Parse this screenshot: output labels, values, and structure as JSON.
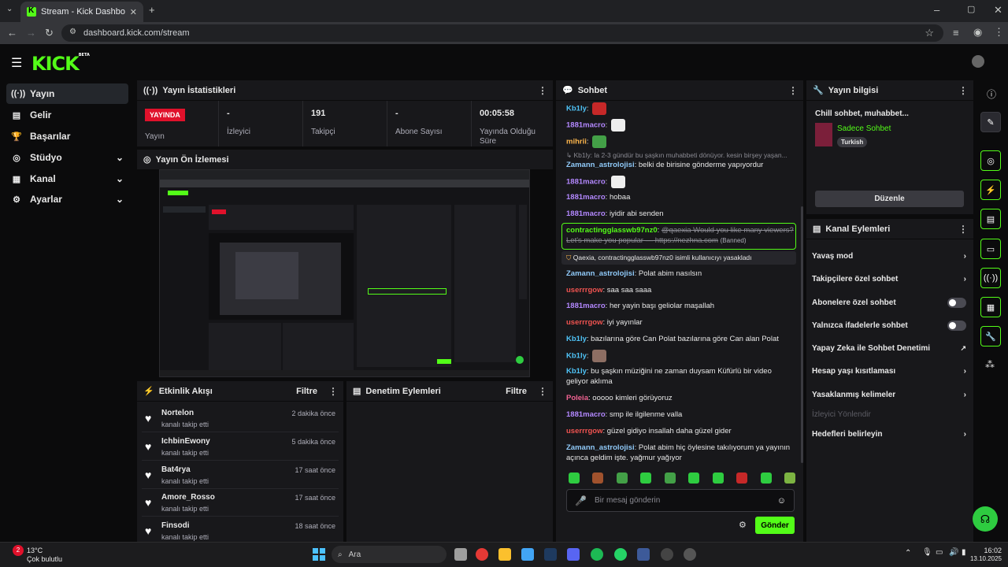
{
  "browser": {
    "tab_title": "Stream - Kick Dashboard",
    "url": "dashboard.kick.com/stream"
  },
  "brand": {
    "logo": "KICK",
    "beta": "BETA",
    "accent": "#53fc18"
  },
  "sidebar": {
    "items": [
      {
        "label": "Yayın",
        "icon": "broadcast-icon"
      },
      {
        "label": "Gelir",
        "icon": "revenue-icon"
      },
      {
        "label": "Başarılar",
        "icon": "trophy-icon"
      },
      {
        "label": "Stüdyo",
        "icon": "studio-icon"
      },
      {
        "label": "Kanal",
        "icon": "channel-icon"
      },
      {
        "label": "Ayarlar",
        "icon": "gear-icon"
      }
    ]
  },
  "stats": {
    "title": "Yayın İstatistikleri",
    "live_badge": "YAYINDA",
    "live_label": "Yayın",
    "viewers_value": "-",
    "viewers_label": "İzleyici",
    "followers_value": "191",
    "followers_label": "Takipçi",
    "subs_value": "-",
    "subs_label": "Abone Sayısı",
    "uptime_value": "00:05:58",
    "uptime_label": "Yayında Olduğu Süre"
  },
  "preview": {
    "title": "Yayın Ön İzlemesi"
  },
  "activity": {
    "title": "Etkinlik Akışı",
    "filter": "Filtre",
    "items": [
      {
        "name": "Nortelon",
        "sub": "kanalı takip etti",
        "time": "2 dakika önce"
      },
      {
        "name": "IchbinEwony",
        "sub": "kanalı takip etti",
        "time": "5 dakika önce"
      },
      {
        "name": "Bat4rya",
        "sub": "kanalı takip etti",
        "time": "17 saat önce"
      },
      {
        "name": "Amore_Rosso",
        "sub": "kanalı takip etti",
        "time": "17 saat önce"
      },
      {
        "name": "Finsodi",
        "sub": "kanalı takip etti",
        "time": "18 saat önce"
      }
    ]
  },
  "moderation": {
    "title": "Denetim Eylemleri",
    "filter": "Filtre"
  },
  "chat": {
    "title": "Sohbet",
    "messages": [
      {
        "user": "Kb1ly",
        "color": "#4fc3f7",
        "text": "",
        "emote": "#c62828"
      },
      {
        "user": "1881macro",
        "color": "#b388ff",
        "text": "",
        "emote": "#eeeeee"
      },
      {
        "user": "mihrii",
        "color": "#ffb74d",
        "text": "",
        "emote": "#43a047"
      },
      {
        "user": "Zamann_astrolojisi",
        "color": "#90caf9",
        "text": "belki de birisine gönderme yapıyordur",
        "reply": "Kb1ly: la 2-3 gündür bu şaşkın muhabbeti dönüyor. kesin birşey yaşan..."
      },
      {
        "user": "1881macro",
        "color": "#b388ff",
        "text": "",
        "emote": "#eeeeee"
      },
      {
        "user": "1881macro",
        "color": "#b388ff",
        "text": "hobaa"
      },
      {
        "user": "1881macro",
        "color": "#b388ff",
        "text": "iyidir abi senden"
      },
      {
        "user": "contractingglasswb97nz0",
        "color": "#53fc18",
        "text": "@qaexia Would you like many viewers? Let's make you popular — https://nezhna.com",
        "banned": "(Banned)"
      },
      {
        "system": "Qaexia, contractingglasswb97nz0 isimli kullanıcıyı yasakladı"
      },
      {
        "user": "Zamann_astrolojisi",
        "color": "#90caf9",
        "text": "Polat abim nasılsın"
      },
      {
        "user": "userrrgow",
        "color": "#ef5350",
        "text": "saa saa saaa"
      },
      {
        "user": "1881macro",
        "color": "#b388ff",
        "text": "her yayin başı geliolar maşallah"
      },
      {
        "user": "userrrgow",
        "color": "#ef5350",
        "text": "iyi yayınlar"
      },
      {
        "user": "Kb1ly",
        "color": "#4fc3f7",
        "text": "bazılarına göre Can Polat bazılarına göre Can alan Polat"
      },
      {
        "user": "Kb1ly",
        "color": "#4fc3f7",
        "text": "",
        "emote": "#8d6e63"
      },
      {
        "user": "Kb1ly",
        "color": "#4fc3f7",
        "text": "bu şaşkın müziğini ne zaman duysam Küfürlü bir video geliyor aklıma"
      },
      {
        "user": "Poleia",
        "color": "#f06292",
        "text": "ooooo kimleri görüyoruz"
      },
      {
        "user": "1881macro",
        "color": "#b388ff",
        "text": "smp ile ilgilenme valla"
      },
      {
        "user": "userrrgow",
        "color": "#ef5350",
        "text": "güzel gidiyo insallah daha güzel gider"
      },
      {
        "user": "Zamann_astrolojisi",
        "color": "#90caf9",
        "text": "Polat abim hiç öylesine takılıyorum ya yayının açınca geldim işte. yağmur yağıyor"
      }
    ],
    "placeholder": "Bir mesaj gönderin",
    "send": "Gönder"
  },
  "stream_info": {
    "title": "Yayın bilgisi",
    "stream_title": "Chill sohbet, muhabbet...",
    "category": "Sadece Sohbet",
    "language": "Turkish",
    "edit": "Düzenle"
  },
  "channel_actions": {
    "title": "Kanal Eylemleri",
    "items": [
      {
        "label": "Yavaş mod",
        "control": "chevron"
      },
      {
        "label": "Takipçilere özel sohbet",
        "control": "chevron"
      },
      {
        "label": "Abonelere özel sohbet",
        "control": "toggle"
      },
      {
        "label": "Yalnızca ifadelerle sohbet",
        "control": "toggle"
      },
      {
        "label": "Yapay Zeka ile Sohbet Denetimi",
        "control": "external"
      },
      {
        "label": "Hesap yaşı kısıtlaması",
        "control": "chevron"
      },
      {
        "label": "Yasaklanmış kelimeler",
        "control": "chevron"
      },
      {
        "label": "İzleyici Yönlendir",
        "control": "disabled"
      },
      {
        "label": "Hedefleri belirleyin",
        "control": "chevron"
      }
    ]
  },
  "taskbar": {
    "weather_temp": "13°C",
    "weather_desc": "Çok bulutlu",
    "weather_badge": "2",
    "search": "Ara",
    "time": "16:02",
    "date": "13.10.2025"
  }
}
